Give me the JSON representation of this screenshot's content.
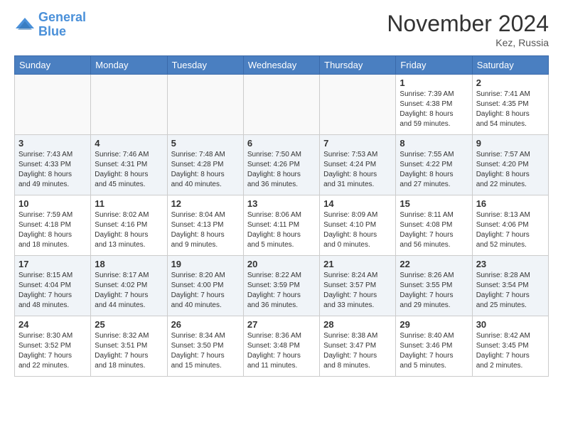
{
  "header": {
    "logo_line1": "General",
    "logo_line2": "Blue",
    "month": "November 2024",
    "location": "Kez, Russia"
  },
  "days_of_week": [
    "Sunday",
    "Monday",
    "Tuesday",
    "Wednesday",
    "Thursday",
    "Friday",
    "Saturday"
  ],
  "weeks": [
    [
      {
        "day": "",
        "info": ""
      },
      {
        "day": "",
        "info": ""
      },
      {
        "day": "",
        "info": ""
      },
      {
        "day": "",
        "info": ""
      },
      {
        "day": "",
        "info": ""
      },
      {
        "day": "1",
        "info": "Sunrise: 7:39 AM\nSunset: 4:38 PM\nDaylight: 8 hours\nand 59 minutes."
      },
      {
        "day": "2",
        "info": "Sunrise: 7:41 AM\nSunset: 4:35 PM\nDaylight: 8 hours\nand 54 minutes."
      }
    ],
    [
      {
        "day": "3",
        "info": "Sunrise: 7:43 AM\nSunset: 4:33 PM\nDaylight: 8 hours\nand 49 minutes."
      },
      {
        "day": "4",
        "info": "Sunrise: 7:46 AM\nSunset: 4:31 PM\nDaylight: 8 hours\nand 45 minutes."
      },
      {
        "day": "5",
        "info": "Sunrise: 7:48 AM\nSunset: 4:28 PM\nDaylight: 8 hours\nand 40 minutes."
      },
      {
        "day": "6",
        "info": "Sunrise: 7:50 AM\nSunset: 4:26 PM\nDaylight: 8 hours\nand 36 minutes."
      },
      {
        "day": "7",
        "info": "Sunrise: 7:53 AM\nSunset: 4:24 PM\nDaylight: 8 hours\nand 31 minutes."
      },
      {
        "day": "8",
        "info": "Sunrise: 7:55 AM\nSunset: 4:22 PM\nDaylight: 8 hours\nand 27 minutes."
      },
      {
        "day": "9",
        "info": "Sunrise: 7:57 AM\nSunset: 4:20 PM\nDaylight: 8 hours\nand 22 minutes."
      }
    ],
    [
      {
        "day": "10",
        "info": "Sunrise: 7:59 AM\nSunset: 4:18 PM\nDaylight: 8 hours\nand 18 minutes."
      },
      {
        "day": "11",
        "info": "Sunrise: 8:02 AM\nSunset: 4:16 PM\nDaylight: 8 hours\nand 13 minutes."
      },
      {
        "day": "12",
        "info": "Sunrise: 8:04 AM\nSunset: 4:13 PM\nDaylight: 8 hours\nand 9 minutes."
      },
      {
        "day": "13",
        "info": "Sunrise: 8:06 AM\nSunset: 4:11 PM\nDaylight: 8 hours\nand 5 minutes."
      },
      {
        "day": "14",
        "info": "Sunrise: 8:09 AM\nSunset: 4:10 PM\nDaylight: 8 hours\nand 0 minutes."
      },
      {
        "day": "15",
        "info": "Sunrise: 8:11 AM\nSunset: 4:08 PM\nDaylight: 7 hours\nand 56 minutes."
      },
      {
        "day": "16",
        "info": "Sunrise: 8:13 AM\nSunset: 4:06 PM\nDaylight: 7 hours\nand 52 minutes."
      }
    ],
    [
      {
        "day": "17",
        "info": "Sunrise: 8:15 AM\nSunset: 4:04 PM\nDaylight: 7 hours\nand 48 minutes."
      },
      {
        "day": "18",
        "info": "Sunrise: 8:17 AM\nSunset: 4:02 PM\nDaylight: 7 hours\nand 44 minutes."
      },
      {
        "day": "19",
        "info": "Sunrise: 8:20 AM\nSunset: 4:00 PM\nDaylight: 7 hours\nand 40 minutes."
      },
      {
        "day": "20",
        "info": "Sunrise: 8:22 AM\nSunset: 3:59 PM\nDaylight: 7 hours\nand 36 minutes."
      },
      {
        "day": "21",
        "info": "Sunrise: 8:24 AM\nSunset: 3:57 PM\nDaylight: 7 hours\nand 33 minutes."
      },
      {
        "day": "22",
        "info": "Sunrise: 8:26 AM\nSunset: 3:55 PM\nDaylight: 7 hours\nand 29 minutes."
      },
      {
        "day": "23",
        "info": "Sunrise: 8:28 AM\nSunset: 3:54 PM\nDaylight: 7 hours\nand 25 minutes."
      }
    ],
    [
      {
        "day": "24",
        "info": "Sunrise: 8:30 AM\nSunset: 3:52 PM\nDaylight: 7 hours\nand 22 minutes."
      },
      {
        "day": "25",
        "info": "Sunrise: 8:32 AM\nSunset: 3:51 PM\nDaylight: 7 hours\nand 18 minutes."
      },
      {
        "day": "26",
        "info": "Sunrise: 8:34 AM\nSunset: 3:50 PM\nDaylight: 7 hours\nand 15 minutes."
      },
      {
        "day": "27",
        "info": "Sunrise: 8:36 AM\nSunset: 3:48 PM\nDaylight: 7 hours\nand 11 minutes."
      },
      {
        "day": "28",
        "info": "Sunrise: 8:38 AM\nSunset: 3:47 PM\nDaylight: 7 hours\nand 8 minutes."
      },
      {
        "day": "29",
        "info": "Sunrise: 8:40 AM\nSunset: 3:46 PM\nDaylight: 7 hours\nand 5 minutes."
      },
      {
        "day": "30",
        "info": "Sunrise: 8:42 AM\nSunset: 3:45 PM\nDaylight: 7 hours\nand 2 minutes."
      }
    ]
  ]
}
